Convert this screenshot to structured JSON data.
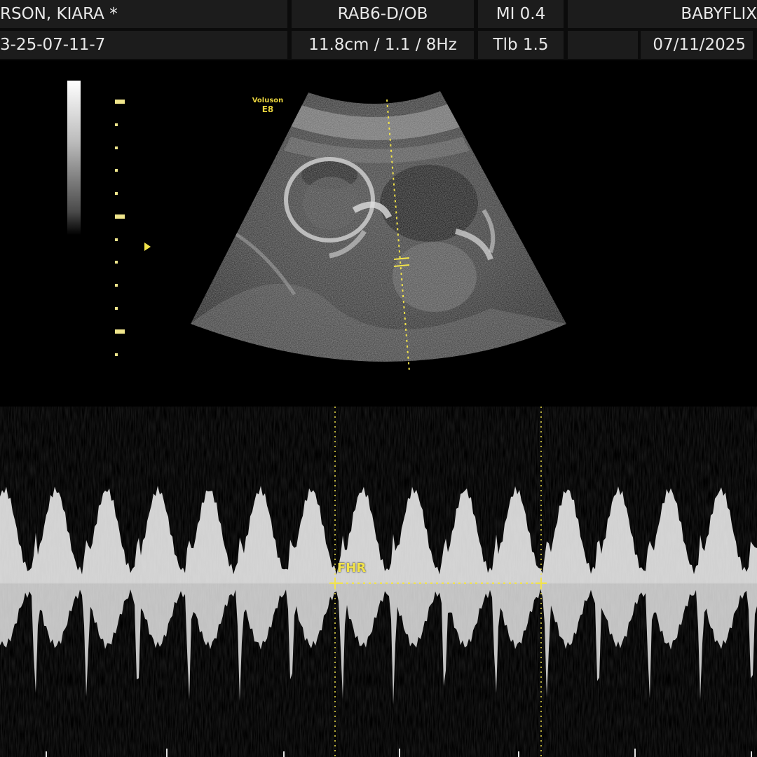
{
  "header": {
    "patient_name": "RSON, KIARA *",
    "patient_id": "3-25-07-11-7",
    "probe_preset": "RAB6-D/OB",
    "depth_info": "11.8cm / 1.1 /  8Hz",
    "mi": "MI  0.4",
    "tib": "Tlb  1.5",
    "clinic": "BABYFLIX",
    "date": "07/11/2025"
  },
  "image": {
    "brand_line1": "Voluson",
    "brand_line2": "E8"
  },
  "doppler": {
    "measurement_label": "FHR"
  },
  "colors": {
    "accent_yellow": "#f2e34a",
    "header_cell": "#1c1c1c",
    "background": "#000000"
  }
}
